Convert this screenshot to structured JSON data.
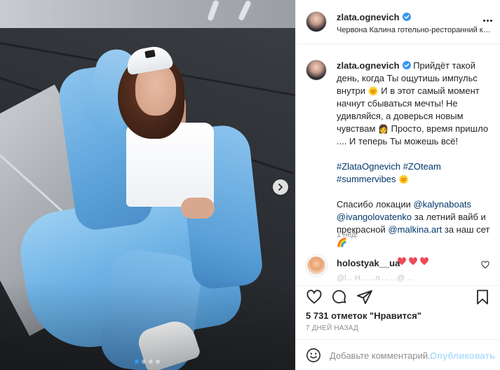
{
  "post": {
    "username": "zlata.ognevich",
    "location": "Червона Калина готельно-ресторанний ко...",
    "caption": {
      "username": "zlata.ognevich",
      "line1": "Прийдёт такой день, когда Ты ощутишь импульс внутри",
      "line2": "И в этот самый момент начнут сбываться мечты! Не удивляйся, а доверься новым чувствам",
      "line3": "Просто, время пришло .... И теперь Ты можешь всё!",
      "hashtags": [
        "#ZlataOgnevich",
        "#ZOteam",
        "#summervibes"
      ],
      "thanks_prefix": "Спасибо локации",
      "mention1": "@kalynaboats",
      "mention2": "@ivangolovatenko",
      "thanks_mid": "за летний вайб и прекрасной",
      "mention3": "@malkina.art",
      "thanks_suffix": "за наш сет",
      "time": "1 нед."
    },
    "top_comment": {
      "username": "holostyak__ua",
      "faded_text": "@l... Н... ...л ... ...@ ..."
    },
    "likes": "5 731 отметок \"Нравится\"",
    "time": "7 ДНЕЙ НАЗАД",
    "comment_placeholder": "Добавьте комментарий...",
    "publish_label": "Опубликовать",
    "carousel": {
      "count": 4,
      "active": 1
    }
  },
  "icons": {
    "verified": "verified-badge-icon",
    "more": "more-options-icon",
    "like": "heart-icon",
    "comment": "comment-icon",
    "share": "share-icon",
    "save": "bookmark-icon",
    "emoji": "emoji-icon",
    "next": "chevron-right-icon"
  },
  "colors": {
    "accent": "#3897f0",
    "verified": "#3897f0",
    "link": "#00376b",
    "heart": "#ed4956",
    "publish_disabled": "#b2dffc"
  }
}
